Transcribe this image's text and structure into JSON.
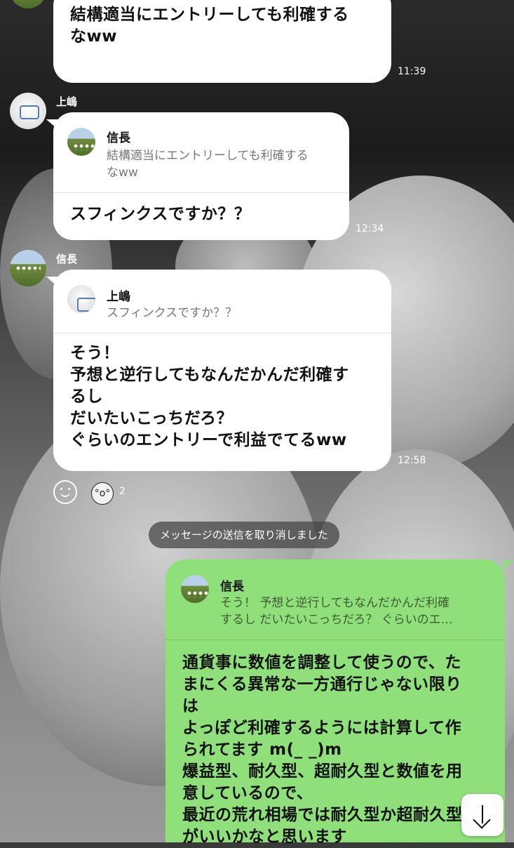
{
  "messages": [
    {
      "sender": "",
      "text": "結構適当にエントリーしても利確する\nなww",
      "time": "11:39"
    },
    {
      "sender": "上嶋",
      "reply_to": {
        "name": "信長",
        "text": "結構適当にエントリーしても利確する\nなww"
      },
      "text": "スフィンクスですか？？",
      "time": "12:34"
    },
    {
      "sender": "信長",
      "reply_to": {
        "name": "上嶋",
        "text": "スフィンクスですか？？"
      },
      "text": "そう！\n予想と逆行してもなんだかんだ利確す\nるし\nだいたいこっちだろ？\nぐらいのエントリーで利益でてるww",
      "time": "12:58",
      "reaction_count": "2"
    },
    {
      "sender": "me",
      "reply_to": {
        "name": "信長",
        "text": "そう！ 予想と逆行してもなんだかんだ利確\nするし だいたいこっちだろ？ ぐらいのエ…"
      },
      "text": "通貨事に数値を調整して使うので、た\nまにくる異常な一方通行じゃない限り\nは\nよっぽど利確するようには計算して作\nられてます m(_ _)m\n爆益型、耐久型、超耐久型と数値を用\n意しているので、\n最近の荒れ相場では耐久型か超耐久型\nがいいかなと思います"
    }
  ],
  "system_message": "メッセージの送信を取り消しました",
  "icons": {
    "reaction_add": "smile-icon",
    "reaction": "wow-face-icon",
    "scroll": "arrow-down-icon"
  },
  "colors": {
    "own_bubble": "#8fe07a",
    "other_bubble": "#ffffff"
  }
}
